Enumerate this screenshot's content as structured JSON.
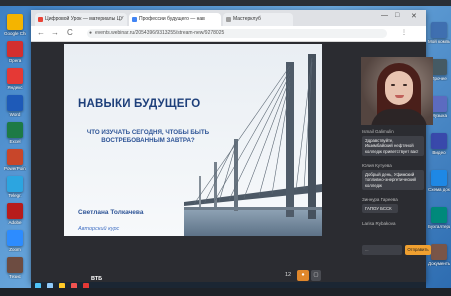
{
  "browser": {
    "tabs": [
      {
        "label": "Цифровой Урок — материалы ЦУ",
        "favicon_color": "#e94235"
      },
      {
        "label": "Профессии будущего — нав",
        "favicon_color": "#4285f4"
      },
      {
        "label": "Мастерклуб",
        "favicon_color": "#9e9e9e"
      }
    ],
    "url": "events.webinar.ru/2054396/9313255/stream-new/9278025",
    "controls": {
      "back": "←",
      "forward": "→",
      "reload": "C",
      "minimize": "—",
      "maximize": "□",
      "close": "✕"
    }
  },
  "slide": {
    "title": "НАВЫКИ БУДУЩЕГО",
    "subtitle": "ЧТО ИЗУЧАТЬ СЕГОДНЯ, ЧТОБЫ БЫТЬ ВОСТРЕБОВАННЫМ ЗАВТРА?",
    "author": "Светлана Толкачева",
    "course": "Авторский курс",
    "logo": "ВТБ",
    "page_number": "12",
    "brand_color": "#1d3f7a"
  },
  "chat": {
    "messages": [
      {
        "author": "Ismail Galimulin",
        "text": "Здравствуйте, Ишимбайский нефтяной колледж приветствует вас!"
      },
      {
        "author": "Юлия Кутуева",
        "text": "Добрый день, Уфимский топливно-энергетический колледж"
      },
      {
        "author": "Зиннура Гареева",
        "text": "ГАПОУ БССК"
      },
      {
        "author": "Larisa Rybakova",
        "text": ""
      }
    ],
    "input_placeholder": "...",
    "send_label": "Отправить"
  },
  "desktop_icons": [
    {
      "label": "Google Chrome",
      "color": "#f4b400"
    },
    {
      "label": "Opera",
      "color": "#d32f2f"
    },
    {
      "label": "Яндекс",
      "color": "#e53935"
    },
    {
      "label": "Word",
      "color": "#1e5ab8"
    },
    {
      "label": "Excel",
      "color": "#1d7a45"
    },
    {
      "label": "PowerPoint",
      "color": "#c8462a"
    },
    {
      "label": "Telegr.",
      "color": "#2ca5e0"
    },
    {
      "label": "Adobe",
      "color": "#b71c1c"
    },
    {
      "label": "Zoom",
      "color": "#2d8cff"
    },
    {
      "label": "Тезис",
      "color": "#6d4c41"
    }
  ],
  "right_icons": [
    {
      "label": "Мой компьютер",
      "color": "#3f6fb0"
    },
    {
      "label": "Прочее",
      "color": "#455a64"
    },
    {
      "label": "Музыка",
      "color": "#5c6bc0"
    },
    {
      "label": "Видео",
      "color": "#3949ab"
    },
    {
      "label": "Схема документ",
      "color": "#1e88e5"
    },
    {
      "label": "Бухгалтерия",
      "color": "#00897b"
    },
    {
      "label": "Документы",
      "color": "#795548"
    }
  ]
}
